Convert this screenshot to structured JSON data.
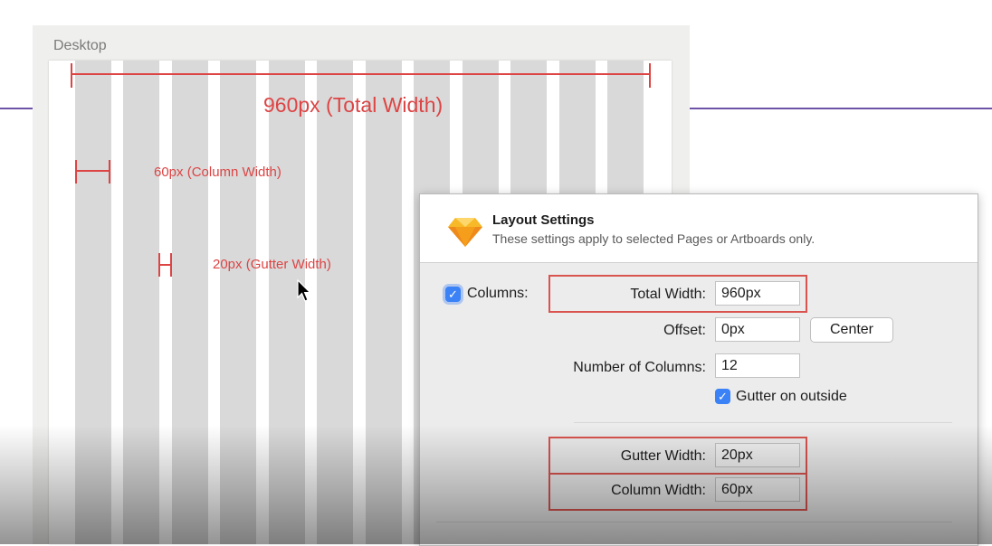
{
  "canvas": {
    "artboard_label": "Desktop",
    "annotations": {
      "total_width": "960px (Total Width)",
      "column_width": "60px (Column Width)",
      "gutter_width": "20px (Gutter Width)"
    },
    "columns_count": 12,
    "colors": {
      "annotation": "#dd4444",
      "column": "#d9d9d9",
      "guide_line": "#6d52a8"
    }
  },
  "dialog": {
    "app_icon": "sketch-gem-icon",
    "title": "Layout Settings",
    "subtitle": "These settings apply to selected Pages or Artboards only.",
    "columns_checkbox": {
      "label": "Columns:",
      "checked": true
    },
    "total_width": {
      "label": "Total Width:",
      "value": "960px"
    },
    "offset": {
      "label": "Offset:",
      "value": "0px"
    },
    "center_button": "Center",
    "number_of_columns": {
      "label": "Number of Columns:",
      "value": "12"
    },
    "gutter_on_outside": {
      "label": "Gutter on outside",
      "checked": true
    },
    "gutter_width": {
      "label": "Gutter Width:",
      "value": "20px"
    },
    "column_width": {
      "label": "Column Width:",
      "value": "60px"
    },
    "colors": {
      "highlight": "#d9534f",
      "checkbox": "#3b82f6"
    }
  }
}
